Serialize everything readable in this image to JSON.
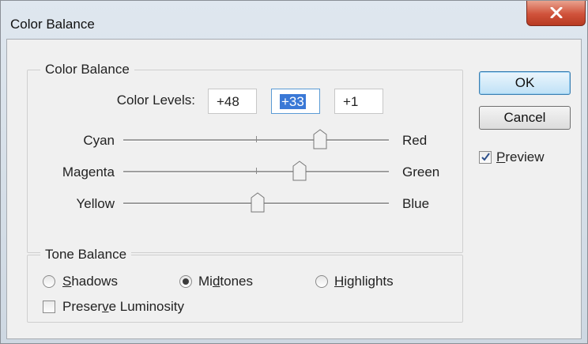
{
  "window": {
    "title": "Color Balance"
  },
  "color_balance": {
    "group_label": "Color Balance",
    "color_levels_label": "Color Levels:",
    "levels": [
      "+48",
      "+33",
      "+1"
    ],
    "level_min": -100,
    "level_max": 100,
    "sliders": [
      {
        "left": "Cyan",
        "right": "Red",
        "value": 48
      },
      {
        "left": "Magenta",
        "right": "Green",
        "value": 33
      },
      {
        "left": "Yellow",
        "right": "Blue",
        "value": 1
      }
    ]
  },
  "tone_balance": {
    "group_label": "Tone Balance",
    "options": [
      {
        "label": "Shadows",
        "selected": false
      },
      {
        "label": "Midtones",
        "selected": true
      },
      {
        "label": "Highlights",
        "selected": false
      }
    ],
    "preserve_luminosity": {
      "label": "Preserve Luminosity",
      "checked": false
    }
  },
  "buttons": {
    "ok": "OK",
    "cancel": "Cancel"
  },
  "preview": {
    "label": "Preview",
    "checked": true
  },
  "colors": {
    "selection": "#3a78d6",
    "close_button": "#d0523a",
    "default_button_border": "#3c7fb1"
  }
}
